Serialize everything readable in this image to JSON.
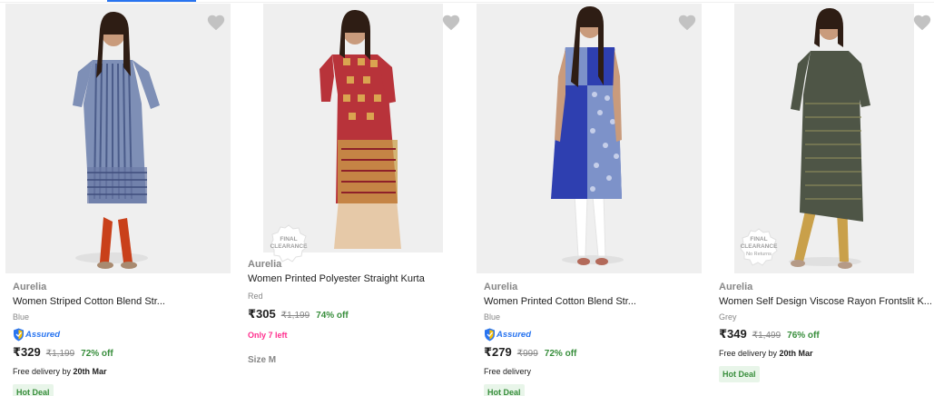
{
  "products": [
    {
      "brand": "Aurelia",
      "title": "Women Striped Cotton Blend Str...",
      "color": "Blue",
      "assured": "Assured",
      "price": "₹329",
      "mrp": "₹1,199",
      "off": "72% off",
      "delivery_prefix": "Free delivery by ",
      "delivery_date": "20th Mar",
      "deal": "Hot Deal",
      "wishlist_icon": "heart-icon"
    },
    {
      "brand": "Aurelia",
      "title": "Women Printed Polyester Straight Kurta",
      "color": "Red",
      "price": "₹305",
      "mrp": "₹1,199",
      "off": "74% off",
      "stock": "Only 7 left",
      "size_label": "Size",
      "size_value": "M",
      "badge_line1": "FINAL",
      "badge_line2": "CLEARANCE",
      "wishlist_icon": "heart-icon"
    },
    {
      "brand": "Aurelia",
      "title": "Women Printed Cotton Blend Str...",
      "color": "Blue",
      "assured": "Assured",
      "price": "₹279",
      "mrp": "₹999",
      "off": "72% off",
      "delivery_prefix": "Free delivery",
      "deal": "Hot Deal",
      "wishlist_icon": "heart-icon"
    },
    {
      "brand": "Aurelia",
      "title": "Women Self Design Viscose Rayon Frontslit K...",
      "color": "Grey",
      "price": "₹349",
      "mrp": "₹1,499",
      "off": "76% off",
      "delivery_prefix": "Free delivery by ",
      "delivery_date": "20th Mar",
      "deal": "Hot Deal",
      "badge_line1": "FINAL",
      "badge_line2": "CLEARANCE",
      "badge_line3": "No Returns",
      "wishlist_icon": "heart-icon"
    }
  ],
  "colors": {
    "accent": "#2874f0",
    "discount": "#388e3c",
    "stock": "#ff2f8e",
    "muted": "#878787"
  }
}
